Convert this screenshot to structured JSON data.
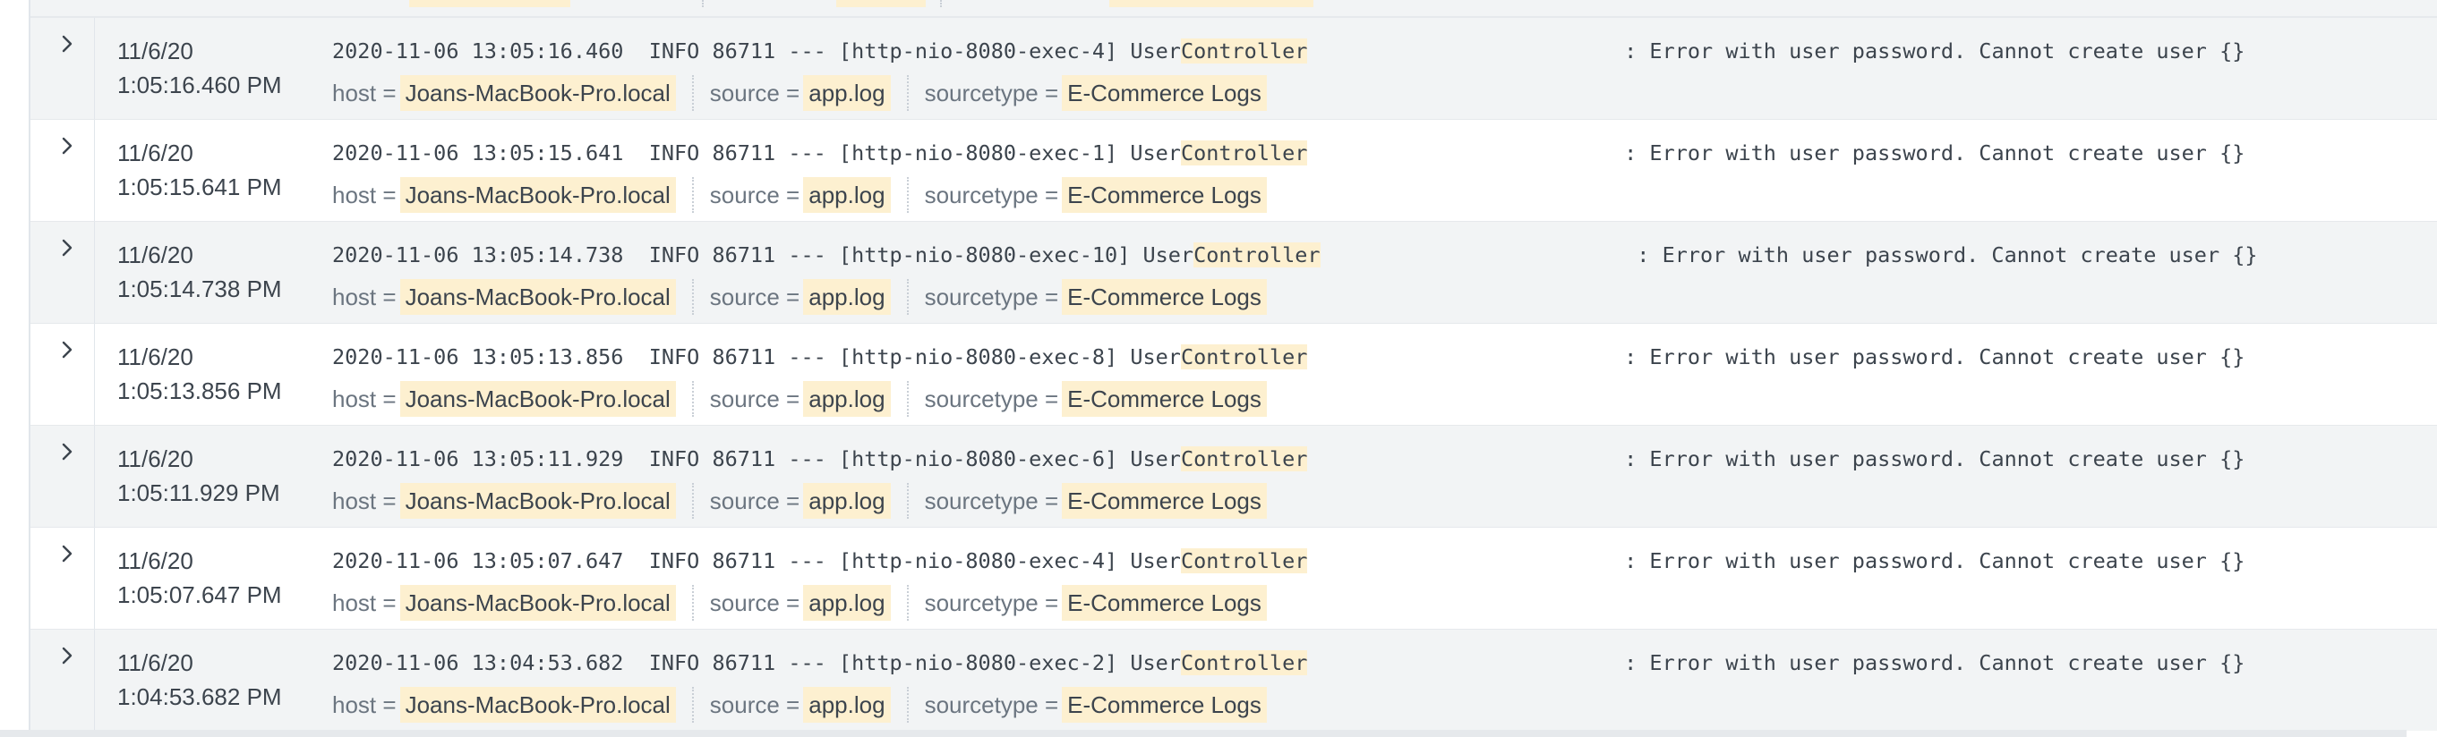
{
  "top_partial": {
    "visible": true
  },
  "events": [
    {
      "date": "11/6/20",
      "time": "1:05:16.460 PM",
      "raw_prefix": "2020-11-06 13:05:16.460  INFO 86711 --- [http-nio-8080-exec-4] User",
      "raw_highlight": "Controller",
      "raw_gap": "                         ",
      "raw_message": ": Error with user password. Cannot create user {}",
      "host_key": "host =",
      "host": "Joans-MacBook-Pro.local",
      "source_key": "source =",
      "source": "app.log",
      "sourcetype_key": "sourcetype =",
      "sourcetype": "E-Commerce Logs"
    },
    {
      "date": "11/6/20",
      "time": "1:05:15.641 PM",
      "raw_prefix": "2020-11-06 13:05:15.641  INFO 86711 --- [http-nio-8080-exec-1] User",
      "raw_highlight": "Controller",
      "raw_gap": "                         ",
      "raw_message": ": Error with user password. Cannot create user {}",
      "host_key": "host =",
      "host": "Joans-MacBook-Pro.local",
      "source_key": "source =",
      "source": "app.log",
      "sourcetype_key": "sourcetype =",
      "sourcetype": "E-Commerce Logs"
    },
    {
      "date": "11/6/20",
      "time": "1:05:14.738 PM",
      "raw_prefix": "2020-11-06 13:05:14.738  INFO 86711 --- [http-nio-8080-exec-10] User",
      "raw_highlight": "Controller",
      "raw_gap": "                         ",
      "raw_message": ": Error with user password. Cannot create user {}",
      "host_key": "host =",
      "host": "Joans-MacBook-Pro.local",
      "source_key": "source =",
      "source": "app.log",
      "sourcetype_key": "sourcetype =",
      "sourcetype": "E-Commerce Logs"
    },
    {
      "date": "11/6/20",
      "time": "1:05:13.856 PM",
      "raw_prefix": "2020-11-06 13:05:13.856  INFO 86711 --- [http-nio-8080-exec-8] User",
      "raw_highlight": "Controller",
      "raw_gap": "                         ",
      "raw_message": ": Error with user password. Cannot create user {}",
      "host_key": "host =",
      "host": "Joans-MacBook-Pro.local",
      "source_key": "source =",
      "source": "app.log",
      "sourcetype_key": "sourcetype =",
      "sourcetype": "E-Commerce Logs"
    },
    {
      "date": "11/6/20",
      "time": "1:05:11.929 PM",
      "raw_prefix": "2020-11-06 13:05:11.929  INFO 86711 --- [http-nio-8080-exec-6] User",
      "raw_highlight": "Controller",
      "raw_gap": "                         ",
      "raw_message": ": Error with user password. Cannot create user {}",
      "host_key": "host =",
      "host": "Joans-MacBook-Pro.local",
      "source_key": "source =",
      "source": "app.log",
      "sourcetype_key": "sourcetype =",
      "sourcetype": "E-Commerce Logs"
    },
    {
      "date": "11/6/20",
      "time": "1:05:07.647 PM",
      "raw_prefix": "2020-11-06 13:05:07.647  INFO 86711 --- [http-nio-8080-exec-4] User",
      "raw_highlight": "Controller",
      "raw_gap": "                         ",
      "raw_message": ": Error with user password. Cannot create user {}",
      "host_key": "host =",
      "host": "Joans-MacBook-Pro.local",
      "source_key": "source =",
      "source": "app.log",
      "sourcetype_key": "sourcetype =",
      "sourcetype": "E-Commerce Logs"
    },
    {
      "date": "11/6/20",
      "time": "1:04:53.682 PM",
      "raw_prefix": "2020-11-06 13:04:53.682  INFO 86711 --- [http-nio-8080-exec-2] User",
      "raw_highlight": "Controller",
      "raw_gap": "                         ",
      "raw_message": ": Error with user password. Cannot create user {}",
      "host_key": "host =",
      "host": "Joans-MacBook-Pro.local",
      "source_key": "source =",
      "source": "app.log",
      "sourcetype_key": "sourcetype =",
      "sourcetype": "E-Commerce Logs"
    }
  ],
  "colors": {
    "row_shaded": "#f2f4f5",
    "row_plain": "#ffffff",
    "highlight": "#fdf0d0",
    "text": "#3c444d",
    "muted": "#6b7580"
  },
  "icons": {
    "expand": "chevron-right-icon"
  }
}
